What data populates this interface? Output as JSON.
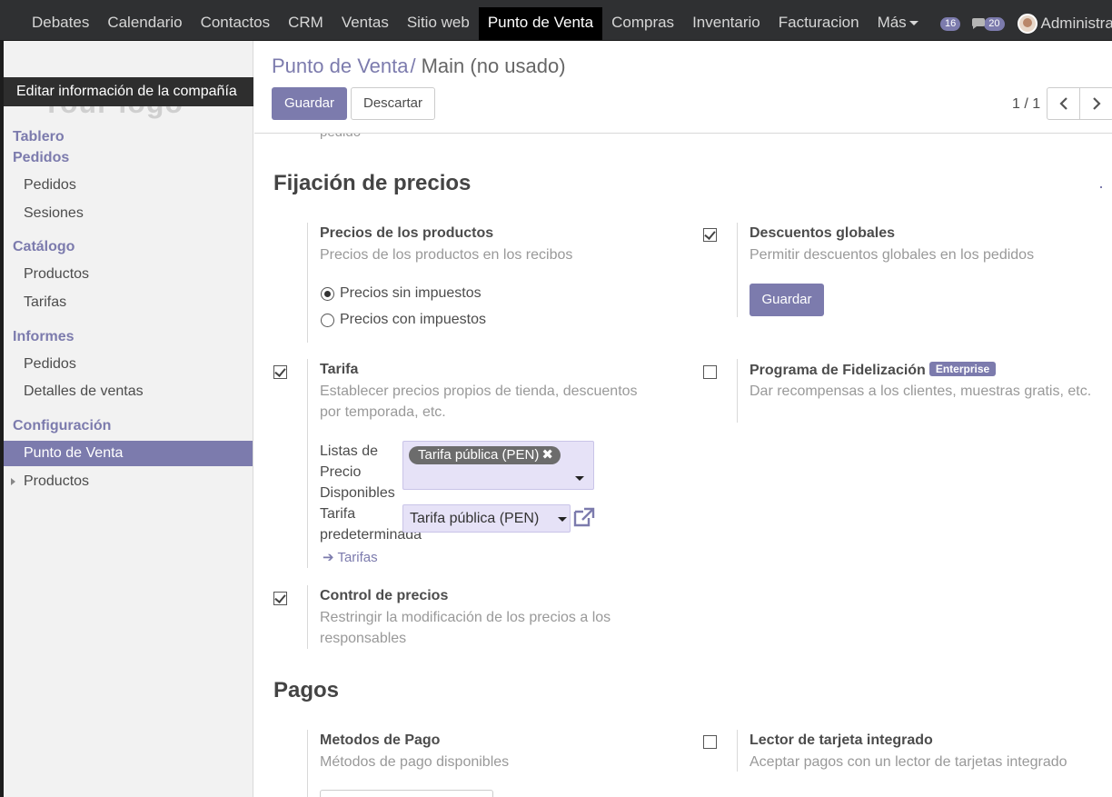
{
  "topbar": {
    "menu": [
      "Debates",
      "Calendario",
      "Contactos",
      "CRM",
      "Ventas",
      "Sitio web",
      "Punto de Venta",
      "Compras",
      "Inventario",
      "Facturacion",
      "Más"
    ],
    "active_index": 6,
    "activity_count": "16",
    "message_count": "20",
    "user_name": "Administrator"
  },
  "sidebar": {
    "logo_placeholder": "Your logo",
    "logo_tooltip": "Editar información de la compañía",
    "groups": {
      "dashboard": "Tablero",
      "orders": "Pedidos",
      "catalog": "Catálogo",
      "reports": "Informes",
      "config": "Configuración"
    },
    "items": {
      "orders": "Pedidos",
      "sessions": "Sesiones",
      "products": "Productos",
      "pricelists": "Tarifas",
      "report_orders": "Pedidos",
      "sales_details": "Detalles de ventas",
      "pos": "Punto de Venta",
      "config_products": "Productos"
    }
  },
  "control": {
    "breadcrumb_parent": "Punto de Venta",
    "breadcrumb_sep": "/",
    "breadcrumb_current": "Main (no usado)",
    "save_label": "Guardar",
    "discard_label": "Descartar",
    "pager": "1 / 1"
  },
  "content": {
    "clipped_text": "pedido",
    "pricing_title": "Fijación de precios",
    "product_prices": {
      "title": "Precios de los productos",
      "desc": "Precios de los productos en los recibos",
      "options": [
        "Precios sin impuestos",
        "Precios con impuestos"
      ],
      "selected": 0
    },
    "global_discounts": {
      "title": "Descuentos globales",
      "desc": "Permitir descuentos globales en los pedidos",
      "checked": true,
      "button": "Guardar"
    },
    "pricelist": {
      "title": "Tarifa",
      "desc": "Establecer precios propios de tienda, descuentos por temporada, etc.",
      "checked": true,
      "available_label": "Listas de Precio Disponibles",
      "available_tag": "Tarifa pública (PEN)",
      "tag_remove": "✖",
      "default_label": "Tarifa predeterminada",
      "default_value": "Tarifa pública (PEN)",
      "link": "Tarifas"
    },
    "loyalty": {
      "title": "Programa de Fidelización",
      "badge": "Enterprise",
      "desc": "Dar recompensas a los clientes, muestras gratis, etc.",
      "checked": false
    },
    "price_control": {
      "title": "Control de precios",
      "desc": "Restringir la modificación de los precios a los responsables",
      "checked": true
    },
    "payments_title": "Pagos",
    "payment_methods": {
      "title": "Metodos de Pago",
      "desc": "Métodos de pago disponibles"
    },
    "card_reader": {
      "title": "Lector de tarjeta integrado",
      "desc": "Aceptar pagos con un lector de tarjetas integrado",
      "checked": false
    }
  },
  "colors": {
    "accent": "#7c7bad",
    "topbar": "#2f3032",
    "field_bg": "#e6e2f7"
  }
}
